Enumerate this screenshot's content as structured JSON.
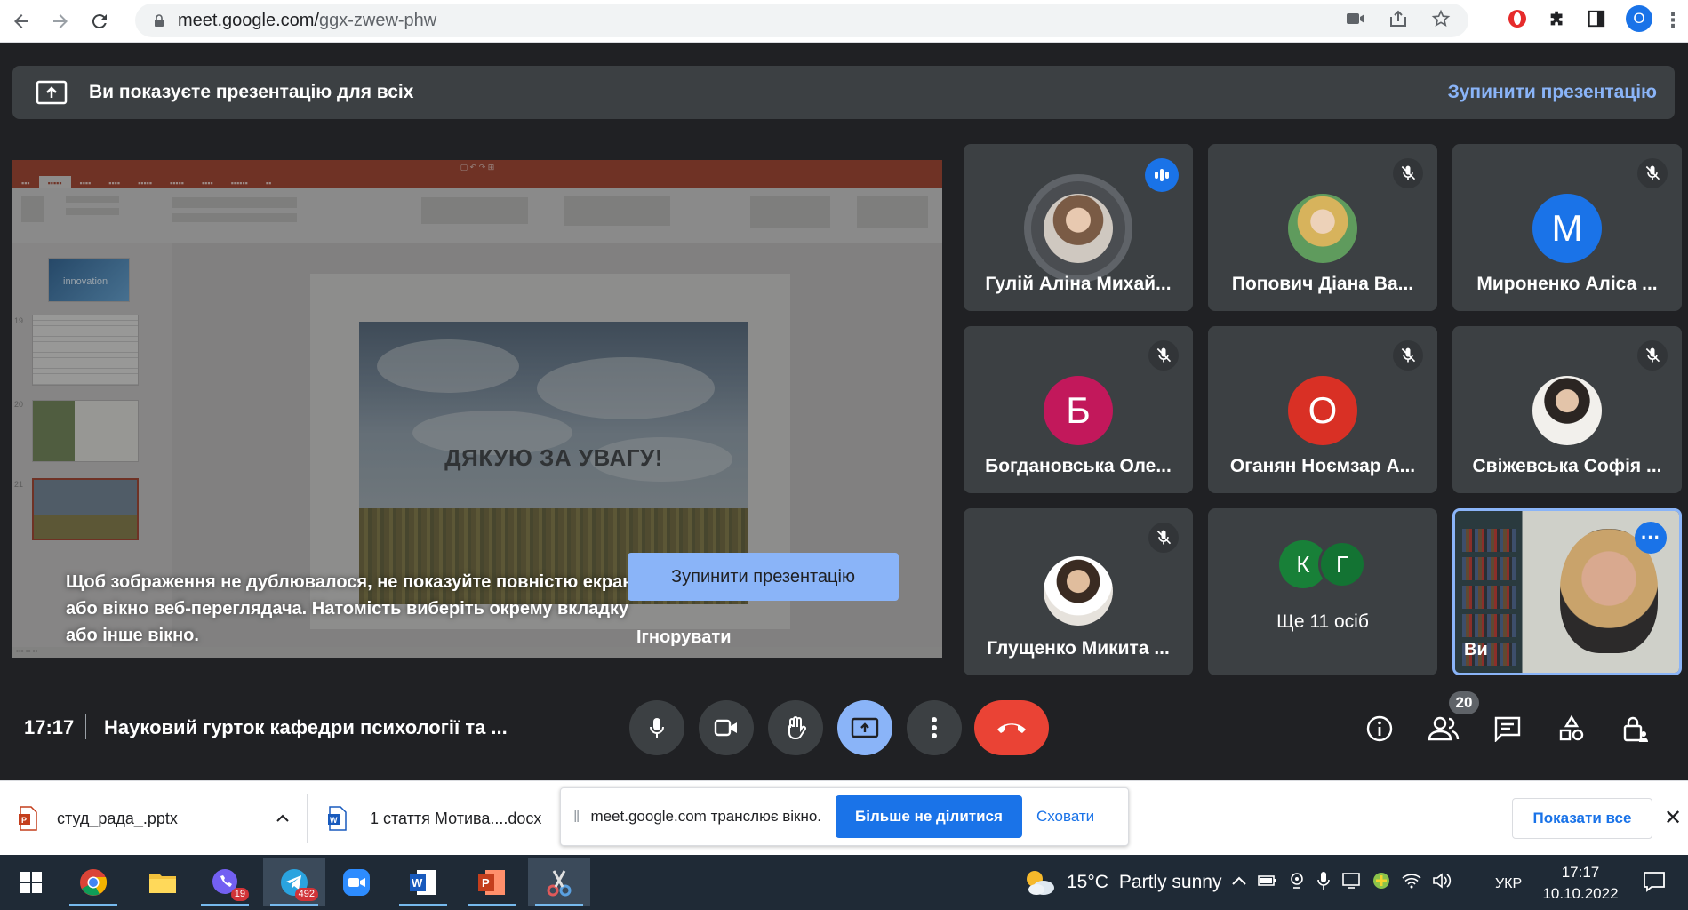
{
  "browser": {
    "url_host": "meet.google.com/",
    "url_path": "ggx-zwew-phw",
    "profile_initial": "O"
  },
  "banner": {
    "message": "Ви показуєте презентацію для всіх",
    "stop_label": "Зупинити презентацію"
  },
  "presentation": {
    "slide_text": "ДЯКУЮ ЗА УВАГУ!",
    "thumb_label": "innovation",
    "hint": "Щоб зображення не дублювалося, не показуйте повністю екран або вікно веб-переглядача. Натомість виберіть окрему вкладку або інше вікно.",
    "stop_button": "Зупинити презентацію",
    "ignore_button": "Ігнорувати"
  },
  "participants": [
    {
      "name": "Гулій Аліна Михай...",
      "avatar": "photo",
      "status": "speaking"
    },
    {
      "name": "Попович Діана Ва...",
      "avatar": "photo",
      "status": "muted"
    },
    {
      "name": "Мироненко Аліса ...",
      "initial": "М",
      "color": "#1a73e8",
      "status": "muted"
    },
    {
      "name": "Богдановська Оле...",
      "initial": "Б",
      "color": "#c2185b",
      "status": "muted"
    },
    {
      "name": "Оганян Ноємзар А...",
      "initial": "О",
      "color": "#d93025",
      "status": "muted"
    },
    {
      "name": "Свіжевська Софія ...",
      "avatar": "photo",
      "status": "muted"
    },
    {
      "name": "Глущенко Микита ...",
      "avatar": "photo",
      "status": "muted"
    }
  ],
  "others": {
    "initials": [
      "К",
      "Г"
    ],
    "colors": [
      "#188038",
      "#137333"
    ],
    "label": "Ще 11 осіб"
  },
  "self": {
    "label": "Ви"
  },
  "controls": {
    "time": "17:17",
    "meeting_title": "Науковий гурток кафедри психології та ...",
    "participants_count": "20"
  },
  "downloads": {
    "item1": "студ_рада_.pptx",
    "item2": "1 стаття Мотива....docx",
    "share_text": "meet.google.com транслює вікно.",
    "share_stop": "Більше не ділитися",
    "share_hide": "Сховати",
    "show_all": "Показати все"
  },
  "taskbar": {
    "viber_badge": "19",
    "telegram_badge": "492",
    "temperature": "15°C",
    "weather_text": "Partly sunny",
    "language": "УКР",
    "time": "17:17",
    "date": "10.10.2022"
  },
  "colors": {
    "meet_bg": "#202124",
    "tile_bg": "#3c4043",
    "accent": "#8ab4f8",
    "end_call": "#ea4335",
    "chrome_blue": "#1a73e8"
  }
}
